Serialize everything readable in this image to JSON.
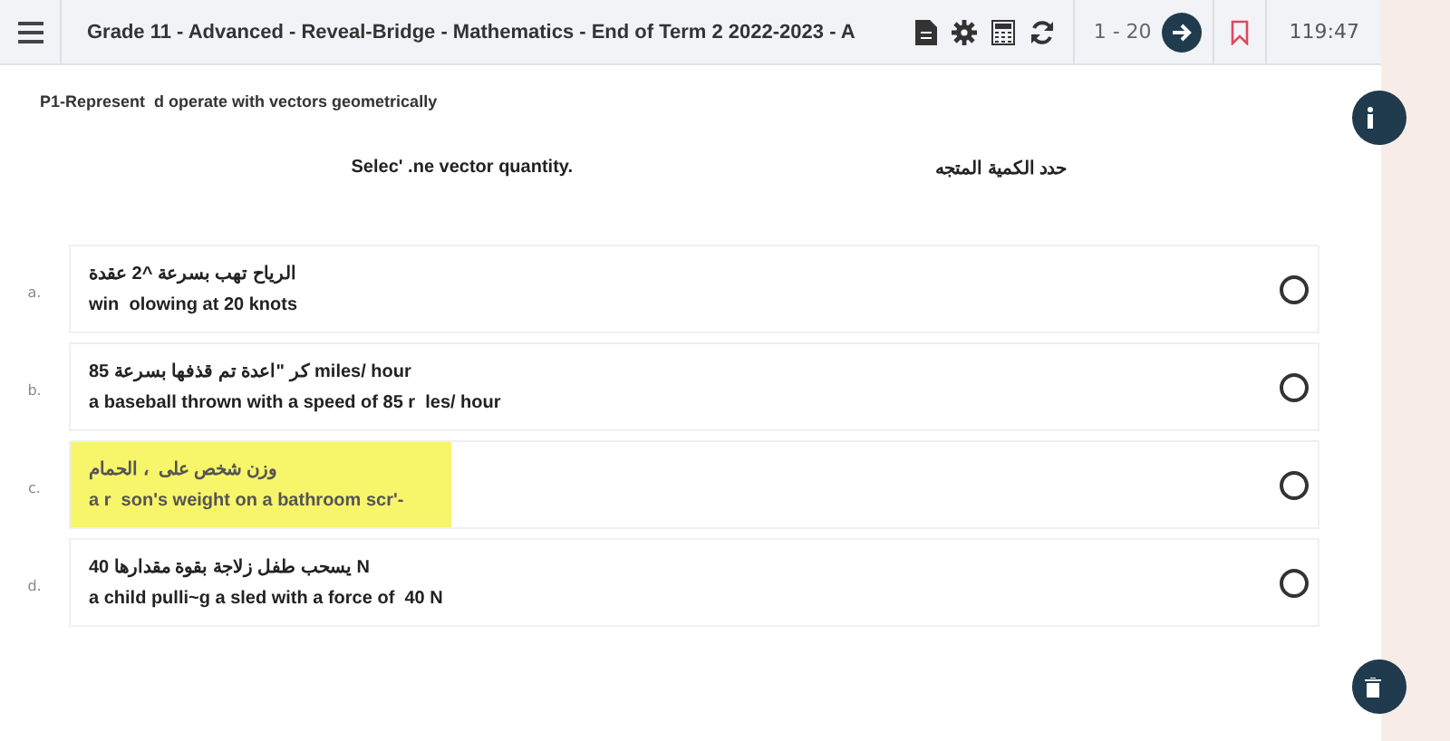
{
  "header": {
    "title": "Grade 11 - Advanced - Reveal-Bridge - Mathematics - End of Term 2 2022-2023 - A",
    "range": "1 - 20",
    "timer": "119:47",
    "bookmarked": false
  },
  "objective": "P1-Represent  d operate with vectors geometrically",
  "question": {
    "english": "Selec' .ne vector quantity.",
    "arabic": "حدد الكمية المتجه"
  },
  "options": [
    {
      "letter": "a.",
      "arabic": "الرياح تهب بسرعة ^2 عقدة",
      "english": "win  olowing at 20 knots",
      "highlighted": false,
      "selected": false
    },
    {
      "letter": "b.",
      "arabic": "كر \"اعدة تم قذفها بسرعة 85 miles/ hour",
      "english": "a baseball thrown with a speed of 85 r  les/ hour",
      "highlighted": false,
      "selected": false
    },
    {
      "letter": "c.",
      "arabic": "وزن شخص على  ، الحمام",
      "english": "a r  son's weight on a bathroom scr'-",
      "highlighted": true,
      "selected": false
    },
    {
      "letter": "d.",
      "arabic": "يسحب طفل زلاجة بقوة مقدارها 40 N",
      "english": "a child pulli~g a sled with a force of  40 N",
      "highlighted": false,
      "selected": false
    }
  ]
}
